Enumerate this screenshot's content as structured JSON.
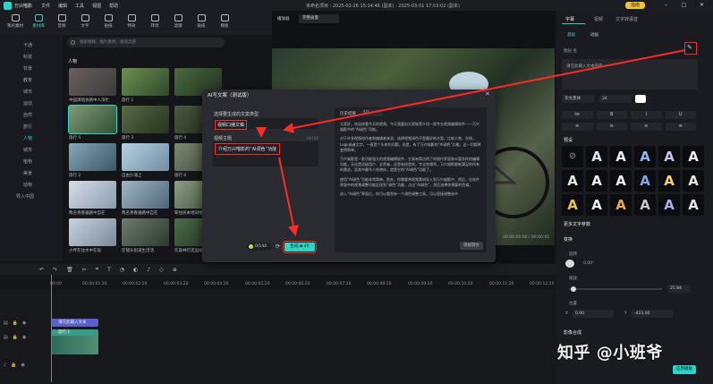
{
  "titlebar": {
    "app_name": "万兴喵影",
    "menu": [
      "文件",
      "编辑",
      "工具",
      "视图",
      "帮助"
    ],
    "doc_title": "未命名项目 : 2025-02-26 15:14:46 (副本) : 2025-03-01 17:53:02 (副本)",
    "upgrade_label": "指南"
  },
  "toolbar": {
    "items": [
      "我的素材",
      "素材库",
      "音频",
      "文字",
      "贴纸",
      "特效",
      "转场",
      "滤镜",
      "贴纸",
      "模板"
    ]
  },
  "left_nav": {
    "items": [
      "卡通",
      "科技",
      "背景",
      "教育",
      "城市",
      "运动",
      "自然",
      "旅行",
      "人物",
      "城市",
      "植物",
      "美食",
      "动物"
    ],
    "active_index": 8,
    "footer": "导入中国"
  },
  "media": {
    "search_placeholder": "搜索视频、图片素材，发现灵感",
    "filter_label": "全部",
    "category_title": "人物",
    "items": [
      {
        "label": "中国演唱会路中人浓忙"
      },
      {
        "label": "旅行 1"
      },
      {
        "label": ""
      },
      {
        "label": "旅行 5"
      },
      {
        "label": "旅行 3"
      },
      {
        "label": "旅行 4"
      },
      {
        "label": "旅行 2"
      },
      {
        "label": "自由沙滩上"
      },
      {
        "label": "旅行 6"
      },
      {
        "label": "两名青春遍路中自在"
      },
      {
        "label": "两名青春遍路中自在"
      },
      {
        "label": "新住民本地同地宏"
      },
      {
        "label": "小伴在住水中在居"
      },
      {
        "label": "在镜头街道生活活"
      },
      {
        "label": "在森林行走运动"
      }
    ]
  },
  "preview": {
    "label": "播放器",
    "quality": "完整质量"
  },
  "dialog": {
    "title": "AI写文案（测试版）",
    "type_label": "选择要生成的文案类型",
    "type_value": "视频口播文稿",
    "topic_label": "视频主题",
    "topic_count": "19/100",
    "topic_value": "介绍万兴喵影的“AI调色”功能",
    "history_label": "历史结果",
    "history_value": "1/1",
    "credits": "0/144",
    "generate_label": "生成 ◆ 40",
    "apply_label": "添加到文",
    "body": [
      "大家好，欢迎收看今天的视频。今天我要向大家推荐介绍一款专业视频编辑软件——万兴喵影中的“AI调色”功能。",
      "对于许多视频创作者和编辑者来说，选择视频调色不是最好的方案，比较人物，光线，Logo或者文字，一直是个头疼的问题。但是，有了万兴喵影的“AI调色”功能，这一切都将变得简单。",
      "万兴喵影是一款功能强大的视频编辑软件，它具有简洁明了的操作界面和丰富多样的编辑功能，无论是初级用户、业余者，还是有经验的，专业剪辑师，万兴喵影都能满足你所有的需求。而其中最令人惊艳的，就是它的“AI调色”功能了。",
      "使用“AI调色”功能非常简单。首先，你需要将视频素材导入到万兴喵影中，然后，在软件界面中的视频调整功能区找到“调色”功能，点击“AI调色”，然后选择你想要的色调。",
      "进入“AI调色”界面后，你可以看到有一个调色调整工具，可以直接调整选中"
    ]
  },
  "right_panel": {
    "tabs": [
      "字幕",
      "视频",
      "文字转语音"
    ],
    "subtabs": [
      "基础",
      "动画"
    ],
    "field_label": "图层 名",
    "text_placeholder": "请在此输入文本内容",
    "font": "华文黑体",
    "font_size": "24",
    "align_buttons": [
      "I≡",
      "B",
      "I",
      "U",
      "≡",
      "≡",
      "≡",
      "≡"
    ],
    "presets_label": "预设",
    "more_label": "更多文字参数",
    "transform_label": "变换",
    "rotate_label": "旋转",
    "rotate_value": "0.00°",
    "scale_label": "缩放",
    "scale_value": "25.84",
    "position_label": "位置",
    "pos_x": "0.00",
    "pos_y": "-423.00",
    "pos_x_axis": "X",
    "pos_y_axis": "Y",
    "blend_label": "影像合成",
    "apply_label": "应用模板"
  },
  "timeline": {
    "ruler": [
      "00:00",
      "00:00:01:20",
      "00:00:02:20",
      "00:00:03:20",
      "00:00:04:20",
      "00:00:05:20",
      "00:00:06:20",
      "00:00:07:20",
      "00:00:08:20",
      "00:00:09:20",
      "00:00:10:20",
      "00:00:11:20",
      "00:00:12:20"
    ],
    "text_clip": "请在此输入文本",
    "video_clip": "旅行 1",
    "preview_time": "00:00:00:00",
    "preview_total": "00:00:05"
  },
  "watermark": "知乎 @小班爷",
  "colors": {
    "accent": "#2ed3c6",
    "annotation": "#ff2a2a",
    "background": "#141519"
  }
}
